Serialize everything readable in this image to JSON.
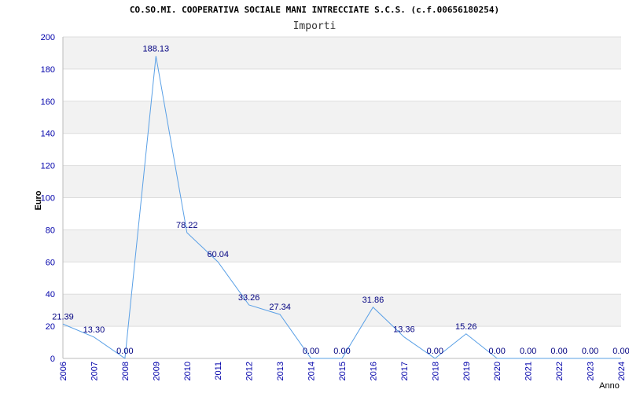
{
  "title": "CO.SO.MI. COOPERATIVA SOCIALE MANI INTRECCIATE S.C.S. (c.f.00656180254)",
  "subtitle": "Importi",
  "chart_data": {
    "type": "line",
    "x": [
      "2006",
      "2007",
      "2008",
      "2009",
      "2010",
      "2011",
      "2012",
      "2013",
      "2014",
      "2015",
      "2016",
      "2017",
      "2018",
      "2019",
      "2020",
      "2021",
      "2022",
      "2023",
      "2024"
    ],
    "values": [
      21.39,
      13.3,
      0.0,
      188.13,
      78.22,
      60.04,
      33.26,
      27.34,
      0.0,
      0.0,
      31.86,
      13.36,
      0.0,
      15.26,
      0.0,
      0.0,
      0.0,
      0.0,
      0.0
    ],
    "labels": [
      "21.39",
      "13.30",
      "0.00",
      "188.13",
      "78.22",
      "60.04",
      "33.26",
      "27.34",
      "0.00",
      "0.00",
      "31.86",
      "13.36",
      "0.00",
      "15.26",
      "0.00",
      "0.00",
      "0.00",
      "0.00",
      "0.00"
    ],
    "ylabel": "Euro",
    "xlabel": "Anno",
    "ylim": [
      0,
      200
    ],
    "yticks": [
      0,
      20,
      40,
      60,
      80,
      100,
      120,
      140,
      160,
      180,
      200
    ],
    "grid": true,
    "line_color": "#5aa0e6",
    "label_color": "#000080",
    "tick_color": "#0000aa",
    "band_color": "#f2f2f2"
  }
}
